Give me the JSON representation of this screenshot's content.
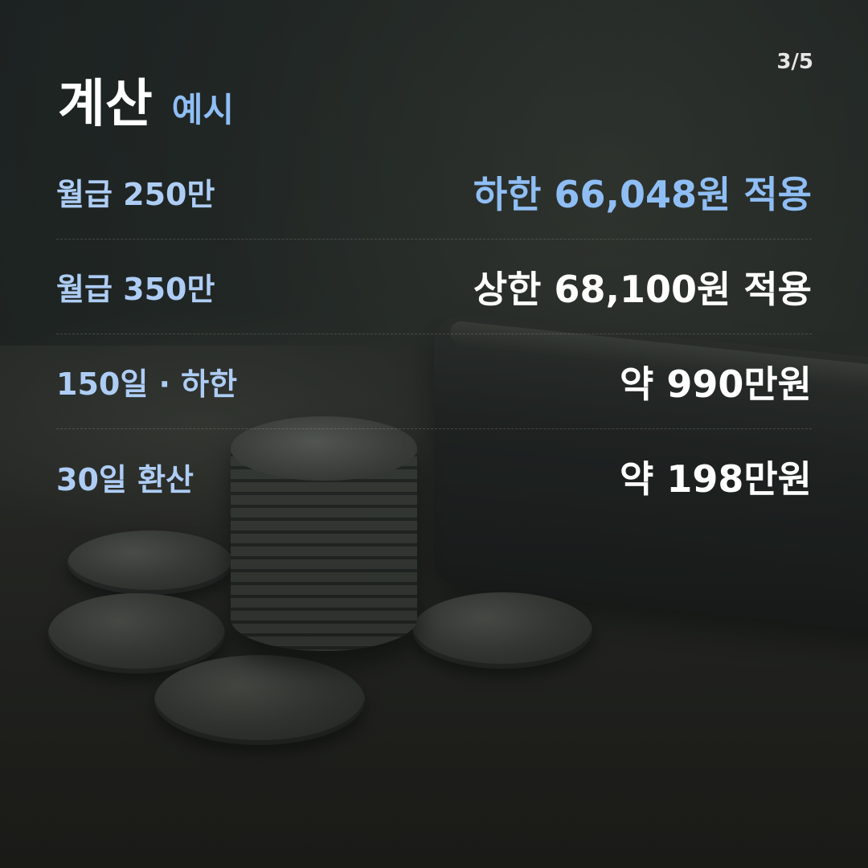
{
  "page_indicator": "3/5",
  "title": {
    "main": "계산",
    "sub": "예시"
  },
  "rows": [
    {
      "label": "월급 250만",
      "value": "하한 66,048원 적용",
      "highlight": true
    },
    {
      "label": "월급 350만",
      "value": "상한 68,100원 적용",
      "highlight": false
    },
    {
      "label": "150일 · 하한",
      "value": "약 990만원",
      "highlight": false
    },
    {
      "label": "30일 환산",
      "value": "약 198만원",
      "highlight": false
    }
  ],
  "colors": {
    "accent": "#8fbef5",
    "label": "#aecdf5",
    "value": "#ffffff"
  }
}
